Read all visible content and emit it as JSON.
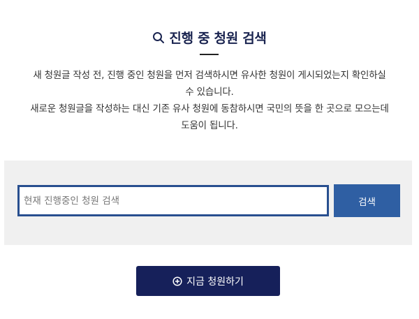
{
  "header": {
    "title": "진행 중 청원 검색",
    "icon": "search-icon"
  },
  "description": {
    "line1": "새 청원글 작성 전, 진행 중인 청원을 먼저 검색하시면 유사한 청원이 게시되었는지 확인하실",
    "line2": "수 있습니다.",
    "line3": "새로운 청원글을 작성하는 대신 기존 유사 청원에 동참하시면 국민의 뜻을 한 곳으로 모으는데",
    "line4": "도움이 됩니다."
  },
  "search": {
    "placeholder": "현재 진행중인 청원 검색",
    "value": "",
    "button_label": "검색"
  },
  "actions": {
    "petition_label": "지금 청원하기",
    "petition_icon": "plus-circle-icon"
  },
  "colors": {
    "title": "#1a2450",
    "panel_background": "#f0f0f0",
    "input_border": "#284f8f",
    "search_button": "#2f5fa3",
    "petition_button": "#16205a"
  }
}
